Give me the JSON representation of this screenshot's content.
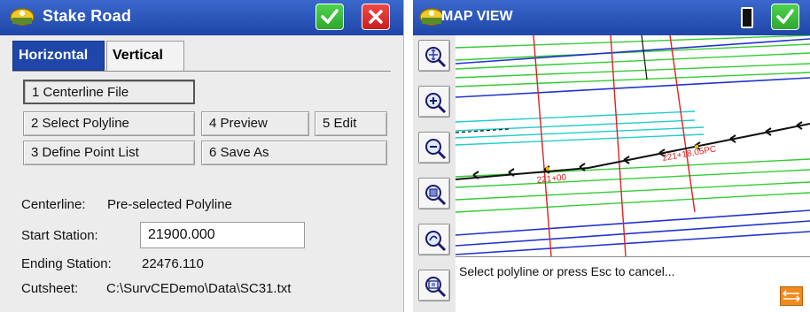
{
  "stake_road": {
    "title": "Stake Road",
    "tabs": [
      {
        "label": "Horizontal",
        "active": true
      },
      {
        "label": "Vertical",
        "active": false
      }
    ],
    "buttons": {
      "centerline_file": "1 Centerline File",
      "select_polyline": "2 Select Polyline",
      "define_point_list": "3 Define Point List",
      "preview": "4 Preview",
      "edit": "5 Edit",
      "save_as": "6 Save As"
    },
    "centerline": {
      "label": "Centerline:",
      "value": "Pre-selected Polyline"
    },
    "start_station": {
      "label": "Start Station:",
      "value": "21900.000"
    },
    "ending_station": {
      "label": "Ending Station:",
      "value": "22476.110"
    },
    "cutsheet": {
      "label": "Cutsheet:",
      "value": "C:\\SurvCEDemo\\Data\\SC31.txt"
    }
  },
  "map_view": {
    "title": "MAP VIEW",
    "station_labels": [
      "221+00",
      "221+18.05PC"
    ],
    "status_message": "Select polyline or press Esc to cancel..."
  },
  "colors": {
    "titlebar": "#1f46a8",
    "ok": "#2ea72e",
    "cancel": "#c81e1e",
    "map_green": "#33cc33",
    "map_blue": "#2233cc",
    "map_cyan": "#22cccc",
    "map_red": "#dd2222",
    "alignment": "#111111"
  }
}
